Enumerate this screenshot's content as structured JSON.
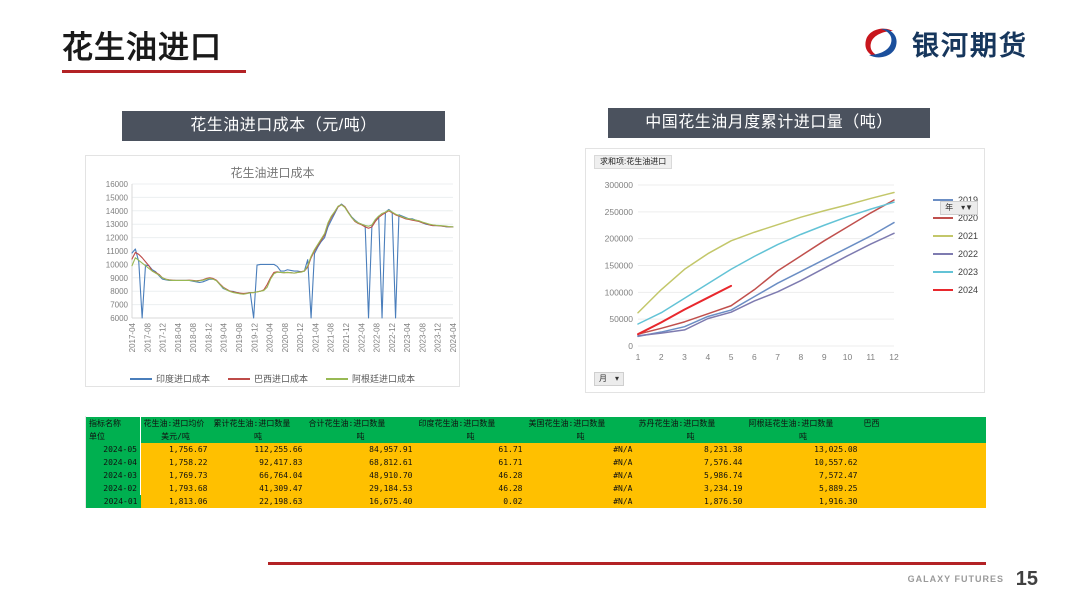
{
  "header": {
    "title": "花生油进口",
    "brand_name": "银河期货",
    "brand_mark": "galaxy-swirl-logo"
  },
  "panels": {
    "left_heading": "花生油进口成本（元/吨）",
    "right_heading": "中国花生油月度累计进口量（吨）"
  },
  "footer": {
    "brand": "GALAXY FUTURES",
    "page_number": "15"
  },
  "chart_data": [
    {
      "id": "import-cost-chart",
      "type": "line",
      "title": "花生油进口成本",
      "xlabel": "",
      "ylabel": "",
      "ylim": [
        6000,
        16000
      ],
      "ytick_labels": [
        "16000",
        "15000",
        "14000",
        "13000",
        "12000",
        "11000",
        "10000",
        "9000",
        "8000",
        "7000",
        "6000"
      ],
      "grid": true,
      "legend_position": "bottom",
      "xtick_labels": [
        "2017-04",
        "2017-08",
        "2017-12",
        "2018-04",
        "2018-08",
        "2018-12",
        "2019-04",
        "2019-08",
        "2019-12",
        "2020-04",
        "2020-08",
        "2020-12",
        "2021-04",
        "2021-08",
        "2021-12",
        "2022-04",
        "2022-08",
        "2022-12",
        "2023-04",
        "2023-08",
        "2023-12",
        "2024-04"
      ],
      "series": [
        {
          "name": "印度进口成本",
          "color": "#4a7ebb",
          "values": [
            10850,
            11150,
            10200,
            6000,
            9950,
            9900,
            9600,
            9450,
            9150,
            8900,
            8850,
            8800,
            8800,
            8800,
            8800,
            8800,
            8800,
            8800,
            8750,
            8700,
            8650,
            8700,
            8800,
            8900,
            8900,
            8800,
            8500,
            8200,
            8100,
            8000,
            7980,
            7900,
            7850,
            7800,
            7850,
            7900,
            6000,
            9950,
            10000,
            10000,
            10000,
            10000,
            10000,
            9850,
            9500,
            9500,
            9600,
            9550,
            9500,
            9500,
            9450,
            9500,
            10350,
            6000,
            10800,
            11300,
            11700,
            12000,
            12800,
            13300,
            13800,
            14300,
            14500,
            14300,
            13900,
            13550,
            13300,
            13100,
            13000,
            12900,
            6000,
            12900,
            13300,
            13600,
            6000,
            13900,
            14100,
            13900,
            6000,
            13700,
            13600,
            13500,
            13400,
            13400,
            13300,
            13200,
            13100,
            13000,
            12950,
            12900,
            12900,
            12900,
            12850,
            12800,
            12800,
            12800
          ]
        },
        {
          "name": "巴西进口成本",
          "color": "#be4b48",
          "values": [
            10400,
            10900,
            10750,
            10500,
            10200,
            9900,
            9500,
            9400,
            9250,
            9000,
            8900,
            8850,
            8820,
            8800,
            8800,
            8800,
            8800,
            8820,
            8800,
            8780,
            8800,
            8850,
            8950,
            9000,
            8950,
            8820,
            8550,
            8300,
            8150,
            8000,
            7950,
            7900,
            7850,
            7830,
            7850,
            7900,
            7900,
            7950,
            8000,
            8100,
            8500,
            9000,
            9400,
            9450,
            9400,
            9380,
            9400,
            9380,
            9350,
            9400,
            9450,
            9500,
            9800,
            10500,
            11000,
            11400,
            11800,
            12200,
            13000,
            13500,
            13900,
            14300,
            14450,
            14300,
            13900,
            13500,
            13200,
            13050,
            12950,
            12800,
            12700,
            12800,
            13200,
            13500,
            13700,
            13850,
            14000,
            13850,
            13700,
            13600,
            13500,
            13400,
            13350,
            13300,
            13250,
            13200,
            13100,
            13050,
            12950,
            12900,
            12900,
            12880,
            12850,
            12820,
            12800,
            12800
          ]
        },
        {
          "name": "阿根廷进口成本",
          "color": "#98b954",
          "values": [
            9900,
            10500,
            10300,
            10100,
            9900,
            9700,
            9500,
            9350,
            9200,
            9000,
            8880,
            8830,
            8800,
            8800,
            8800,
            8800,
            8800,
            8800,
            8780,
            8750,
            8780,
            8820,
            8900,
            8950,
            8900,
            8780,
            8500,
            8260,
            8100,
            7980,
            7900,
            7850,
            7800,
            7780,
            7820,
            7880,
            7900,
            7950,
            8000,
            8050,
            8300,
            8900,
            9300,
            9420,
            9400,
            9380,
            9400,
            9380,
            9350,
            9400,
            9420,
            9500,
            9900,
            10600,
            11100,
            11500,
            11900,
            12300,
            13100,
            13600,
            13950,
            14350,
            14450,
            14250,
            13850,
            13500,
            13250,
            13100,
            13000,
            12900,
            12850,
            12950,
            13350,
            13600,
            13800,
            13900,
            14050,
            13900,
            13750,
            13650,
            13550,
            13450,
            13400,
            13350,
            13300,
            13250,
            13150,
            13080,
            13000,
            12950,
            12920,
            12900,
            12880,
            12850,
            12820,
            12800
          ]
        }
      ]
    },
    {
      "id": "monthly-cumulative-import-chart",
      "type": "line",
      "title": "求和项:花生油进口",
      "xlabel": "月",
      "ylabel": "",
      "ylim": [
        0,
        300000
      ],
      "ytick_labels": [
        "300000",
        "250000",
        "200000",
        "150000",
        "100000",
        "50000",
        "0"
      ],
      "xtick_labels": [
        "1",
        "2",
        "3",
        "4",
        "5",
        "6",
        "7",
        "8",
        "9",
        "10",
        "11",
        "12"
      ],
      "grid": true,
      "legend_position": "right",
      "legend_header": "年",
      "month_filter": "月",
      "x": [
        1,
        2,
        3,
        4,
        5,
        6,
        7,
        8,
        9,
        10,
        11,
        12
      ],
      "series": [
        {
          "name": "2019",
          "color": "#6b8ec4",
          "values": [
            18000,
            26000,
            36000,
            55000,
            67000,
            92000,
            117000,
            139000,
            161000,
            183000,
            205000,
            230000
          ]
        },
        {
          "name": "2020",
          "color": "#c0504d",
          "values": [
            22000,
            33000,
            45000,
            60000,
            75000,
            105000,
            140000,
            168000,
            196000,
            222000,
            248000,
            272000
          ]
        },
        {
          "name": "2021",
          "color": "#c3c76a",
          "values": [
            62000,
            105000,
            143000,
            172000,
            196000,
            212000,
            226000,
            240000,
            252000,
            263000,
            275000,
            286000
          ]
        },
        {
          "name": "2022",
          "color": "#7e7bb0",
          "values": [
            19000,
            24000,
            30000,
            51000,
            63000,
            84000,
            101000,
            122000,
            145000,
            168000,
            190000,
            210000
          ]
        },
        {
          "name": "2023",
          "color": "#63c3d6",
          "values": [
            41000,
            62000,
            89000,
            116000,
            143000,
            167000,
            189000,
            208000,
            225000,
            241000,
            255000,
            268000
          ]
        },
        {
          "name": "2024",
          "color": "#e8282d",
          "values": [
            22000,
            44000,
            68000,
            90000,
            112000,
            null,
            null,
            null,
            null,
            null,
            null,
            null
          ]
        }
      ]
    }
  ],
  "table": {
    "row_labels": [
      "指标名称",
      "单位"
    ],
    "columns": [
      {
        "name": "花生油:进口均价",
        "unit": "美元/吨"
      },
      {
        "name": "累计花生油:进口数量:合计",
        "unit": "吨"
      },
      {
        "name": "花生油:进口数量:印度",
        "unit": "吨"
      },
      {
        "name": "花生油:进口数量:美国",
        "unit": "吨"
      },
      {
        "name": "花生油:进口数量:苏丹",
        "unit": "吨"
      },
      {
        "name": "花生油:进口数量:阿根廷",
        "unit": "吨"
      },
      {
        "name": "花生油:进口数量:巴西",
        "unit": "吨"
      }
    ],
    "header_line1": [
      "指标名称",
      "花生油:进口均价",
      "累计花生油:进口数量",
      "合计花生油:进口数量",
      "印度花生油:进口数量",
      "美国花生油:进口数量",
      "苏丹花生油:进口数量",
      "阿根廷花生油:进口数量",
      "巴西"
    ],
    "header_line2": [
      "单位",
      "美元/吨",
      "吨",
      "吨",
      "吨",
      "吨",
      "吨",
      "吨",
      ""
    ],
    "rows": [
      {
        "date": "2024-05",
        "values": [
          "1,756.67",
          "112,255.66",
          "84,957.91",
          "61.71",
          "#N/A",
          "8,231.38",
          "13,025.08"
        ]
      },
      {
        "date": "2024-04",
        "values": [
          "1,758.22",
          "92,417.83",
          "68,812.61",
          "61.71",
          "#N/A",
          "7,576.44",
          "10,557.62"
        ]
      },
      {
        "date": "2024-03",
        "values": [
          "1,769.73",
          "66,764.04",
          "48,910.70",
          "46.28",
          "#N/A",
          "5,986.74",
          "7,572.47"
        ]
      },
      {
        "date": "2024-02",
        "values": [
          "1,793.68",
          "41,309.47",
          "29,184.53",
          "46.28",
          "#N/A",
          "3,234.19",
          "5,889.25"
        ]
      },
      {
        "date": "2024-01",
        "values": [
          "1,813.06",
          "22,198.63",
          "16,675.40",
          "0.02",
          "#N/A",
          "1,876.50",
          "1,916.30"
        ]
      }
    ]
  },
  "colors": {
    "accent_red": "#b32225",
    "panel_head": "#4b525e",
    "table_header_green": "#00b050",
    "table_value_amber": "#ffc000"
  }
}
